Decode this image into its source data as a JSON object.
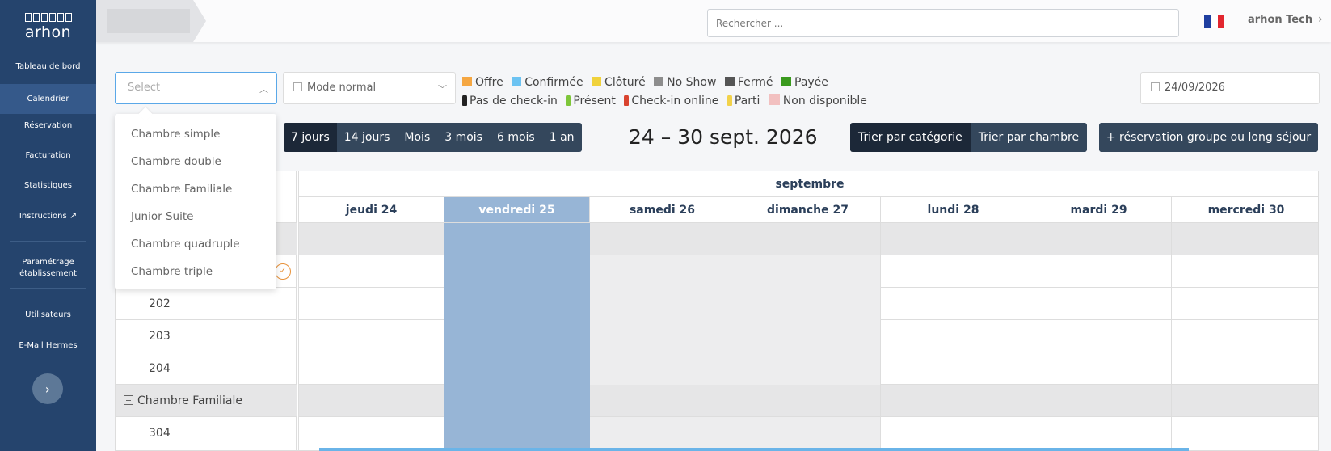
{
  "app": {
    "logo": "arhon",
    "user": "arhon Tech"
  },
  "colors": {
    "sidebar": "#25446d",
    "accent": "#5aa8e8",
    "today": "#97b5d6",
    "button_dark": "#34475c"
  },
  "sidebar": {
    "items": [
      {
        "label": "Tableau de bord"
      },
      {
        "label": "Calendrier",
        "active": true
      },
      {
        "label": "Réservation"
      },
      {
        "label": "Facturation"
      },
      {
        "label": "Statistiques"
      },
      {
        "label": "Instructions"
      },
      {
        "label": "Paramétrage établissement"
      },
      {
        "label": "Utilisateurs"
      },
      {
        "label": "E-Mail Hermes"
      }
    ],
    "expand_icon": "chevron-right-icon"
  },
  "topbar": {
    "search_placeholder": "Rechercher ..."
  },
  "filters": {
    "select_placeholder": "Select",
    "mode": "Mode normal",
    "date": "24/09/2026"
  },
  "legend": {
    "status": [
      {
        "label": "Offre",
        "color": "#f5a742"
      },
      {
        "label": "Confirmée",
        "color": "#6cc3f2"
      },
      {
        "label": "Clôturé",
        "color": "#f0d23c"
      },
      {
        "label": "No Show",
        "color": "#8d8d8d"
      },
      {
        "label": "Fermé",
        "color": "#555555"
      },
      {
        "label": "Payée",
        "color": "#3a9a1e"
      }
    ],
    "presence": [
      {
        "label": "Pas de check-in",
        "color": "#222222"
      },
      {
        "label": "Présent",
        "color": "#7ec63a"
      },
      {
        "label": "Check-in online",
        "color": "#d9432f"
      },
      {
        "label": "Parti",
        "color": "#f2d24a"
      },
      {
        "label": "Non disponible",
        "color": "#f2c0c0"
      }
    ]
  },
  "dropdown": {
    "options": [
      "Chambre simple",
      "Chambre double",
      "Chambre Familiale",
      "Junior Suite",
      "Chambre quadruple",
      "Chambre triple"
    ]
  },
  "range": {
    "buttons": [
      {
        "label": "7 jours",
        "active": true
      },
      {
        "label": "14 jours"
      },
      {
        "label": "Mois"
      },
      {
        "label": "3 mois"
      },
      {
        "label": "6 mois"
      },
      {
        "label": "1 an"
      }
    ],
    "title": "24 – 30 sept. 2026"
  },
  "sort": {
    "by_category": "Trier par catégorie",
    "by_room": "Trier par chambre",
    "group_booking": "+ réservation groupe ou long séjour"
  },
  "calendar": {
    "month": "septembre",
    "days": [
      {
        "label": "jeudi 24"
      },
      {
        "label": "vendredi 25",
        "today": true
      },
      {
        "label": "samedi 26",
        "weekend": true
      },
      {
        "label": "dimanche 27",
        "weekend": true
      },
      {
        "label": "lundi 28"
      },
      {
        "label": "mardi 29"
      },
      {
        "label": "mercredi 30"
      }
    ],
    "rows": [
      {
        "type": "cat",
        "label": ""
      },
      {
        "type": "room",
        "label": ""
      },
      {
        "type": "room",
        "label": "202"
      },
      {
        "type": "room",
        "label": "203"
      },
      {
        "type": "room",
        "label": "204"
      },
      {
        "type": "cat",
        "label": "Chambre Familiale"
      },
      {
        "type": "room",
        "label": "304"
      }
    ]
  }
}
